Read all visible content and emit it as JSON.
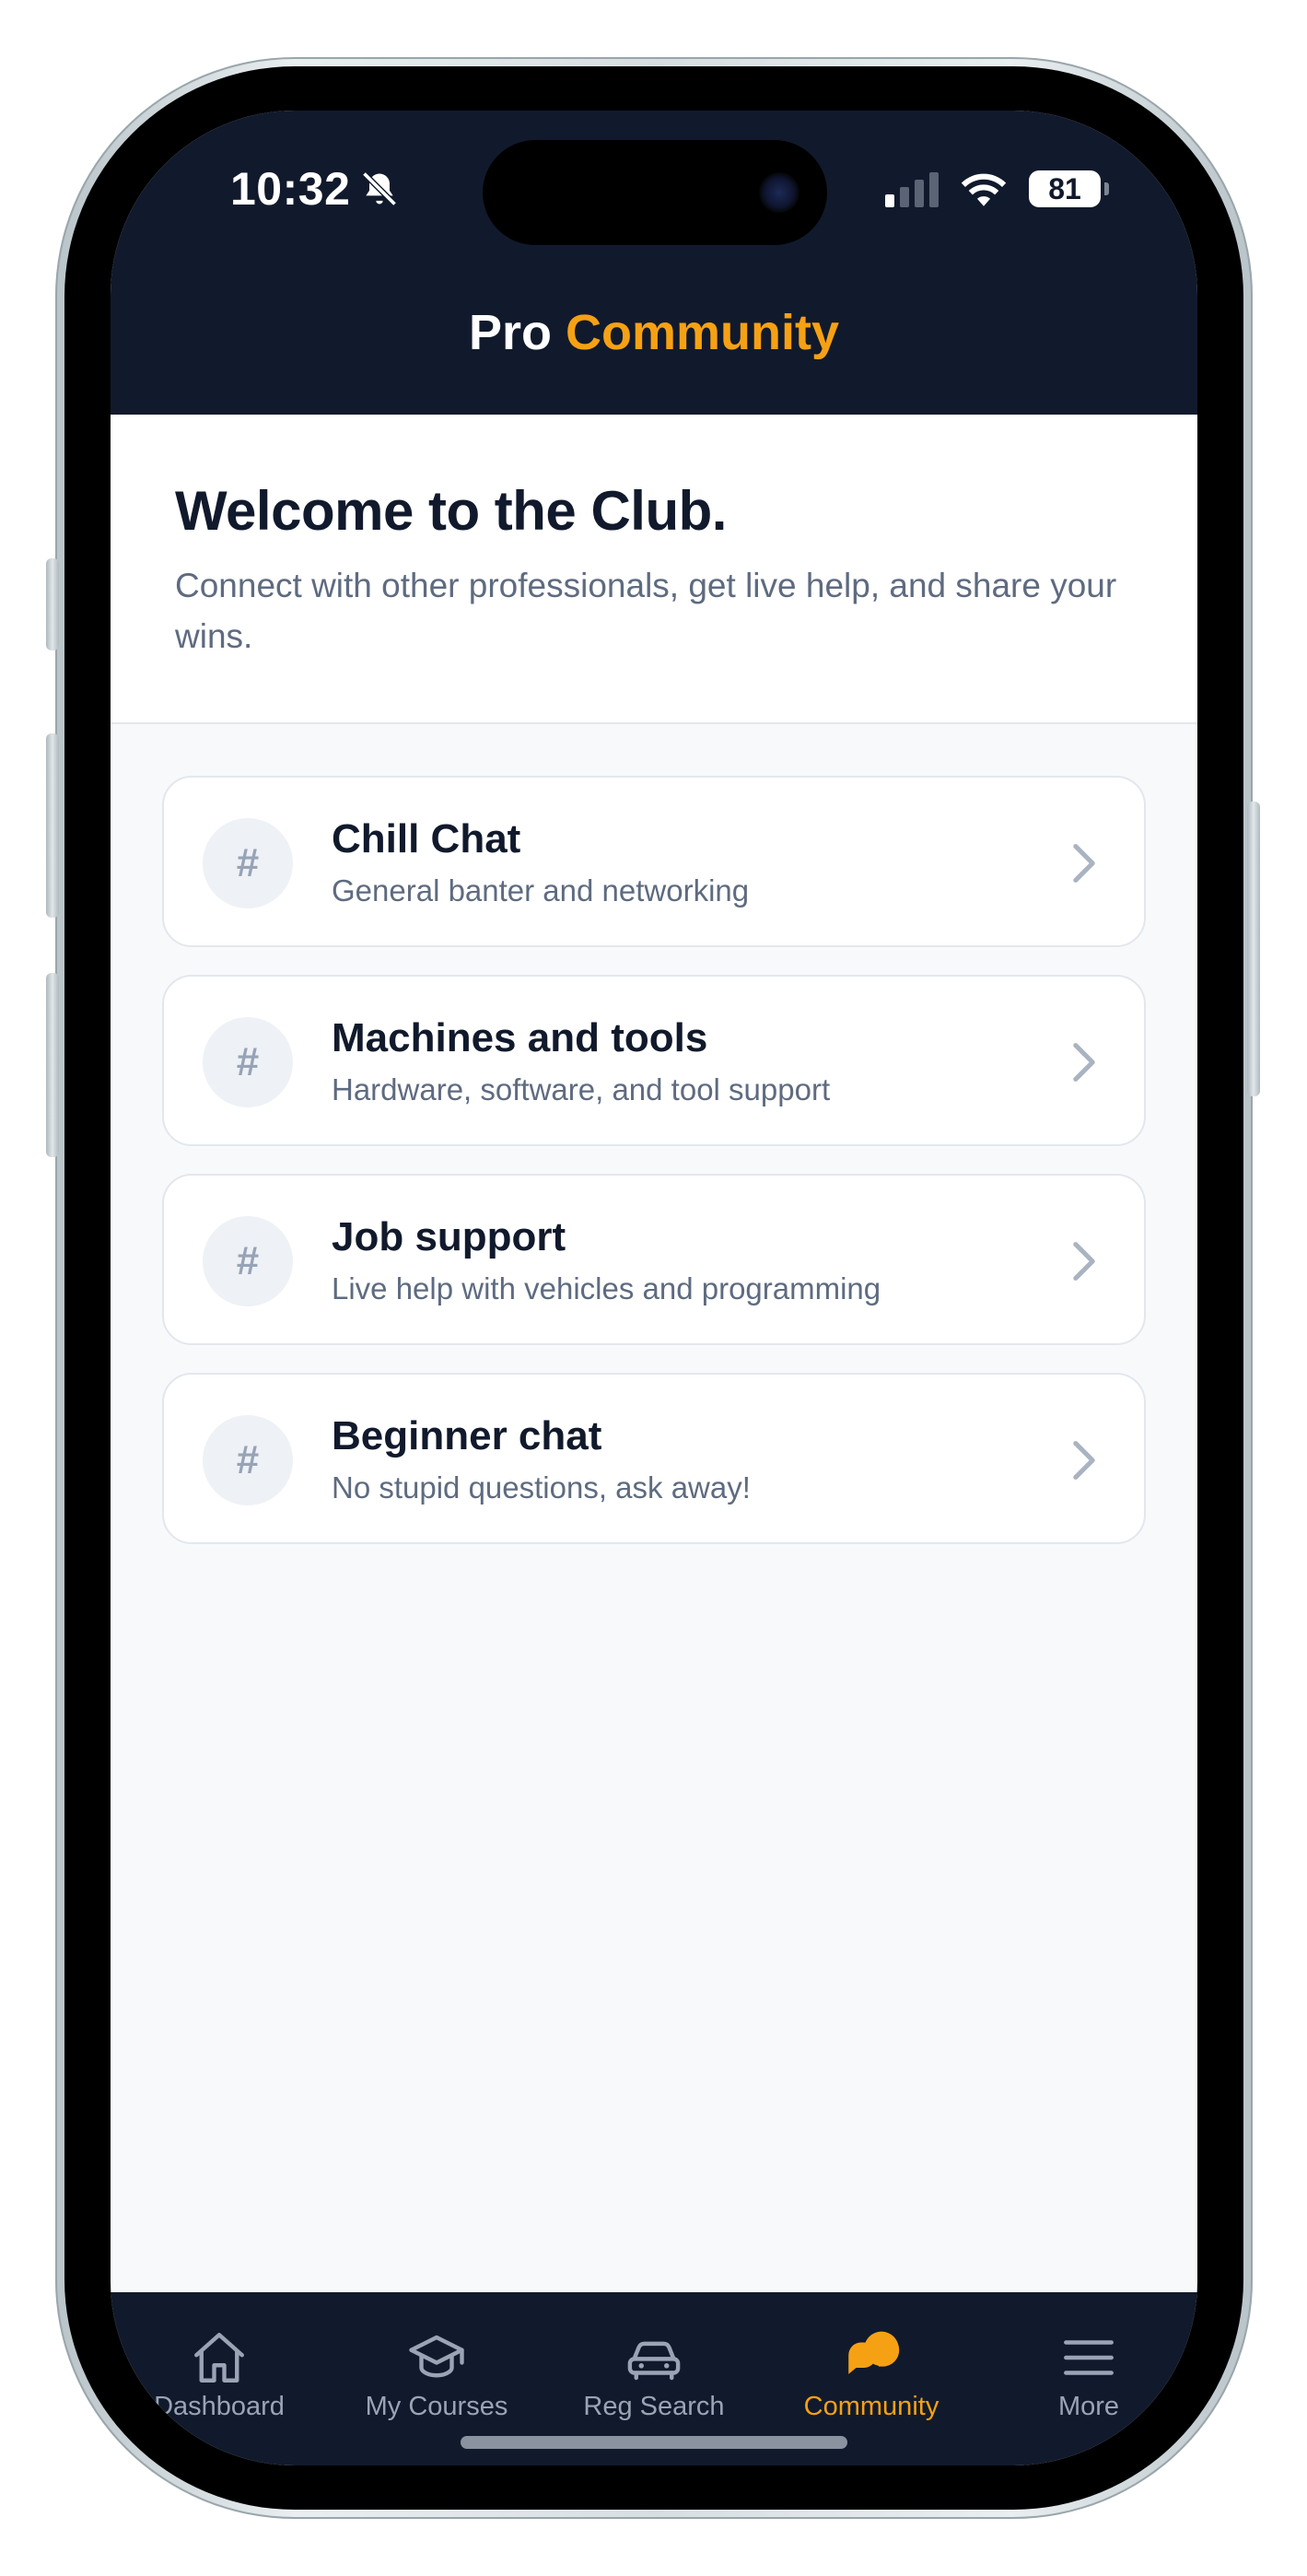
{
  "status_bar": {
    "time": "10:32",
    "battery": "81"
  },
  "header": {
    "title_part1": "Pro",
    "title_part2": "Community"
  },
  "welcome": {
    "heading": "Welcome to the Club.",
    "subtext": "Connect with other professionals, get live help, and share your wins."
  },
  "channels": [
    {
      "icon": "#",
      "name": "Chill Chat",
      "description": "General banter and networking"
    },
    {
      "icon": "#",
      "name": "Machines and tools",
      "description": "Hardware, software, and tool support"
    },
    {
      "icon": "#",
      "name": "Job support",
      "description": "Live help with vehicles and programming"
    },
    {
      "icon": "#",
      "name": "Beginner chat",
      "description": "No stupid questions, ask away!"
    }
  ],
  "tabbar": {
    "tabs": [
      {
        "label": "Dashboard",
        "icon": "home-icon"
      },
      {
        "label": "My Courses",
        "icon": "graduation-cap-icon"
      },
      {
        "label": "Reg Search",
        "icon": "car-icon"
      },
      {
        "label": "Community",
        "icon": "chat-bubbles-icon",
        "active": true
      },
      {
        "label": "More",
        "icon": "menu-icon"
      }
    ]
  },
  "colors": {
    "header_bg": "#111a2c",
    "accent": "#f6a114",
    "background": "#f8f9fb",
    "inactive_tab": "#9aa4b4"
  }
}
